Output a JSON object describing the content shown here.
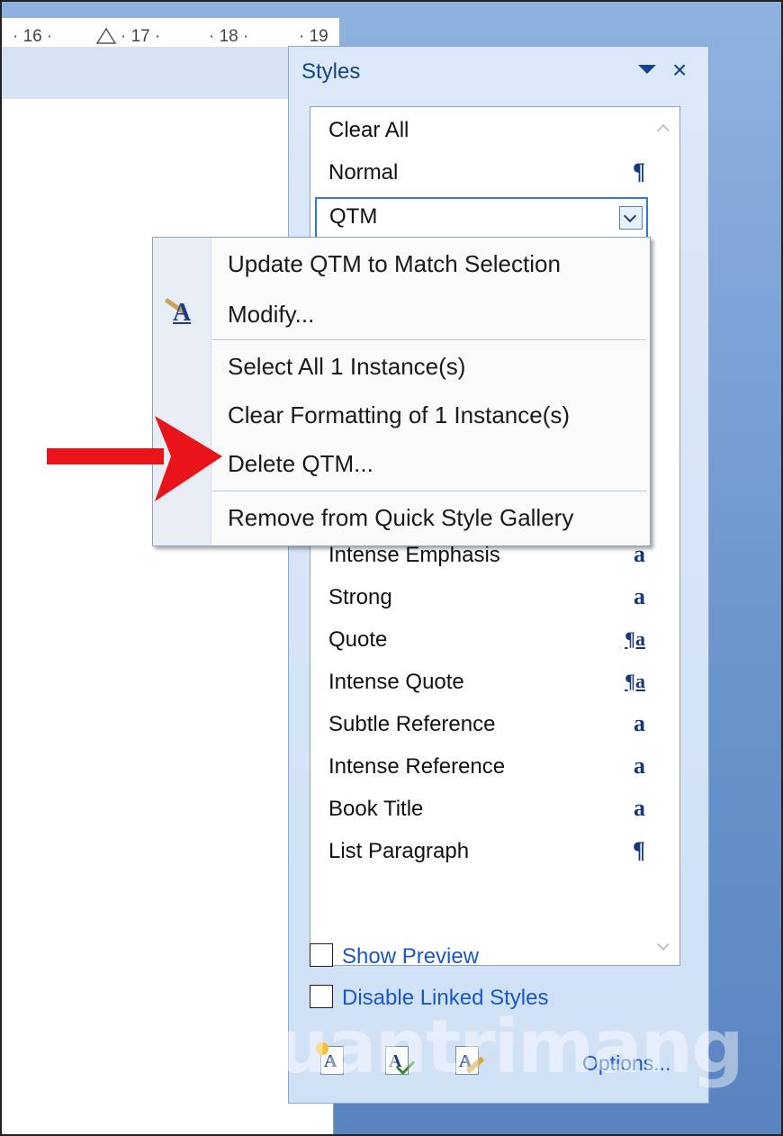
{
  "ruler": {
    "ticks": [
      "· 16 ·",
      "· 17 ·",
      "· 18 ·",
      "· 19"
    ]
  },
  "pane": {
    "title": "Styles",
    "close_glyph": "×"
  },
  "styles_list": {
    "selected": "QTM",
    "items": [
      {
        "name": "Clear All",
        "mark": ""
      },
      {
        "name": "Normal",
        "mark": "¶"
      },
      {
        "name": "QTM",
        "mark": ""
      },
      {
        "name": "Intense Emphasis",
        "mark": "a"
      },
      {
        "name": "Strong",
        "mark": "a"
      },
      {
        "name": "Quote",
        "mark": "¶a"
      },
      {
        "name": "Intense Quote",
        "mark": "¶a"
      },
      {
        "name": "Subtle Reference",
        "mark": "a"
      },
      {
        "name": "Intense Reference",
        "mark": "a"
      },
      {
        "name": "Book Title",
        "mark": "a"
      },
      {
        "name": "List Paragraph",
        "mark": "¶"
      }
    ]
  },
  "context_menu": {
    "items": [
      {
        "label": "Update QTM to Match Selection"
      },
      {
        "label": "Modify..."
      },
      {
        "label": "Select All 1 Instance(s)"
      },
      {
        "label": "Clear Formatting of 1 Instance(s)"
      },
      {
        "label": "Delete QTM..."
      },
      {
        "label": "Remove from Quick Style Gallery"
      }
    ]
  },
  "options": {
    "show_preview": "Show Preview",
    "disable_linked": "Disable Linked Styles",
    "options_link": "Options..."
  },
  "toolbar_icons": [
    "new-style-icon",
    "style-inspector-icon",
    "manage-styles-icon"
  ],
  "colors": {
    "accent": "#15428b",
    "link": "#1757c9",
    "arrow": "#e8141a"
  },
  "watermark": "uantrimang"
}
